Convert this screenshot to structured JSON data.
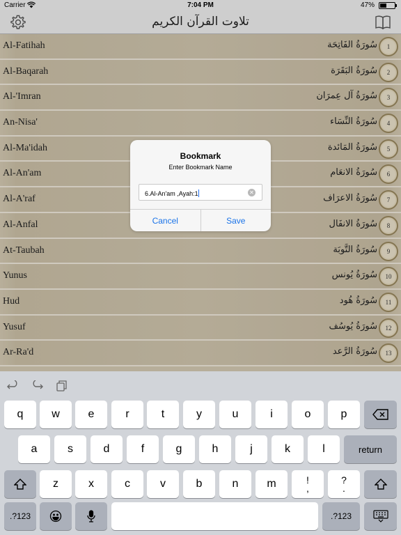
{
  "status_bar": {
    "carrier": "Carrier",
    "time": "7:04 PM",
    "battery": "47%",
    "battery_level": 0.47
  },
  "nav": {
    "title": "تلاوت القرآن الكريم"
  },
  "surahs": [
    {
      "num": "1",
      "en": "Al-Fatihah",
      "ar": "سُورَةُ الفَاتِحَة"
    },
    {
      "num": "2",
      "en": "Al-Baqarah",
      "ar": "سُورَةُ البَقَرَة"
    },
    {
      "num": "3",
      "en": "Al-'Imran",
      "ar": "سُورَةُ آل عِمرَان"
    },
    {
      "num": "4",
      "en": "An-Nisa'",
      "ar": "سُورَةُ النِّسَاء"
    },
    {
      "num": "5",
      "en": "Al-Ma'idah",
      "ar": "سُورَةُ المَائدة"
    },
    {
      "num": "6",
      "en": "Al-An'am",
      "ar": "سُورَةُ الانعَام"
    },
    {
      "num": "7",
      "en": "Al-A'raf",
      "ar": "سُورَةُ الاعرَاف"
    },
    {
      "num": "8",
      "en": "Al-Anfal",
      "ar": "سُورَةُ الانفَال"
    },
    {
      "num": "9",
      "en": "At-Taubah",
      "ar": "سُورَةُ التَّوبَة"
    },
    {
      "num": "10",
      "en": "Yunus",
      "ar": "سُورَةُ يُونس"
    },
    {
      "num": "11",
      "en": "Hud",
      "ar": "سُورَةُ هُود"
    },
    {
      "num": "12",
      "en": "Yusuf",
      "ar": "سُورَةُ يُوسُف"
    },
    {
      "num": "13",
      "en": "Ar-Ra'd",
      "ar": "سُورَةُ الرَّعد"
    }
  ],
  "dialog": {
    "title": "Bookmark",
    "message": "Enter Bookmark Name",
    "input_value": "6.Al-An'am ,Ayah:1",
    "cancel_label": "Cancel",
    "save_label": "Save"
  },
  "keyboard": {
    "row1": [
      "q",
      "w",
      "e",
      "r",
      "t",
      "y",
      "u",
      "i",
      "o",
      "p"
    ],
    "row2": [
      "a",
      "s",
      "d",
      "f",
      "g",
      "h",
      "j",
      "k",
      "l"
    ],
    "row3": [
      "z",
      "x",
      "c",
      "v",
      "b",
      "n",
      "m"
    ],
    "excl": [
      "!",
      ","
    ],
    "quest": [
      "?",
      "."
    ],
    "return_label": "return",
    "num_label": ".?123"
  },
  "colors": {
    "accent": "#1a73e8",
    "medallion": "#9c8a60"
  }
}
